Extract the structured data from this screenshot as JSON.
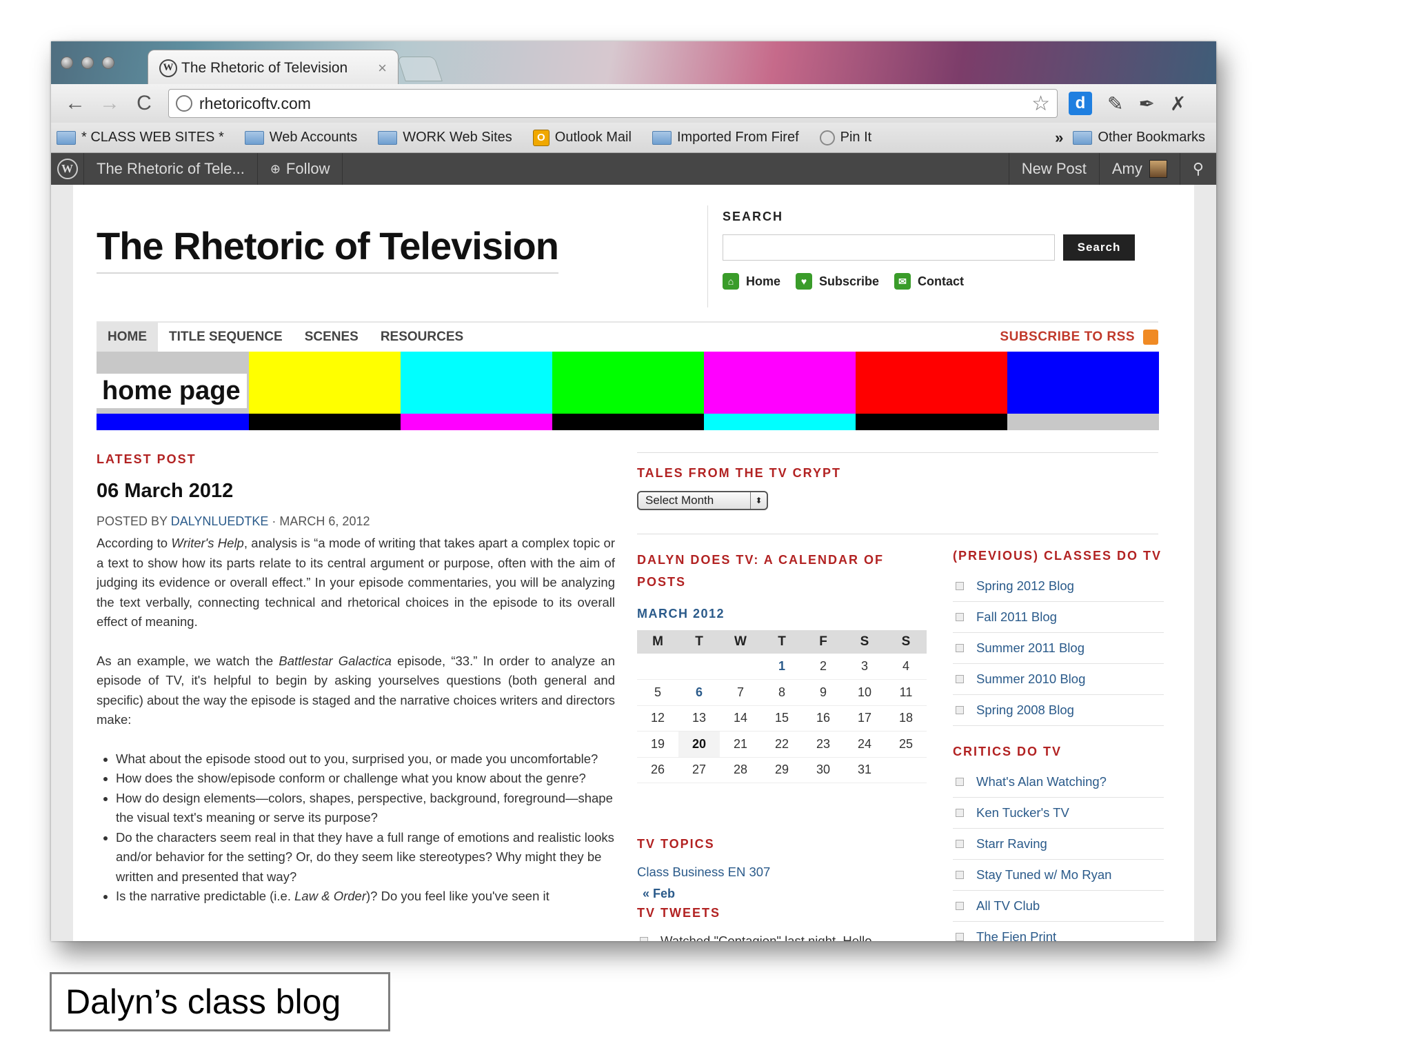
{
  "browser": {
    "tab_title": "The Rhetoric of Television",
    "tab_close": "×",
    "url": "rhetoricoftv.com",
    "nav": {
      "back": "←",
      "forward": "→",
      "reload": "C"
    },
    "star": "☆",
    "ext_d": "d",
    "ext_icons": [
      "puzzle-icon",
      "feather-icon",
      "wrench-icon"
    ],
    "bookmarks": [
      {
        "label": "* CLASS WEB SITES *",
        "kind": "folder"
      },
      {
        "label": "Web Accounts",
        "kind": "folder"
      },
      {
        "label": "WORK Web Sites",
        "kind": "folder"
      },
      {
        "label": "Outlook Mail",
        "kind": "outlook"
      },
      {
        "label": "Imported From Firef",
        "kind": "folder"
      },
      {
        "label": "Pin It",
        "kind": "pin"
      }
    ],
    "bookmarks_more": "»",
    "other_bookmarks": "Other Bookmarks"
  },
  "adminbar": {
    "site": "The Rhetoric of Tele...",
    "follow": "Follow",
    "follow_icon": "⊕",
    "new_post": "New Post",
    "user": "Amy",
    "search_icon": "⚲"
  },
  "header": {
    "site_title": "The Rhetoric of Television",
    "search_label": "SEARCH",
    "search_placeholder": "",
    "search_button": "Search",
    "quicklinks": [
      {
        "label": "Home",
        "icon": "⌂"
      },
      {
        "label": "Subscribe",
        "icon": "♥"
      },
      {
        "label": "Contact",
        "icon": "✉"
      }
    ]
  },
  "nav": {
    "items": [
      "HOME",
      "TITLE SEQUENCE",
      "SCENES",
      "RESOURCES"
    ],
    "active": "HOME",
    "rss": "SUBSCRIBE TO RSS"
  },
  "banner": {
    "label": "home page",
    "top_colors": [
      "#c8c8c8",
      "#ffff00",
      "#00ffff",
      "#00ff00",
      "#ff00ff",
      "#ff0000",
      "#0000ff"
    ],
    "bottom_colors": [
      "#0000ff",
      "#000000",
      "#ff00ff",
      "#000000",
      "#00ffff",
      "#000000",
      "#c8c8c8"
    ]
  },
  "post": {
    "section": "LATEST POST",
    "title": "06 March 2012",
    "byline_prefix": "POSTED BY ",
    "author": "DALYNLUEDTKE",
    "date": " · MARCH 6, 2012",
    "p1_a": "According to ",
    "p1_em": "Writer's Help",
    "p1_b": ", analysis is “a mode of writing that takes apart a complex topic or a text to show how its parts relate to its central argument or purpose, often with the aim of judging its evidence or overall effect.” In your episode commentaries, you will be analyzing the text verbally, connecting technical and rhetorical choices in the episode to its overall effect of meaning.",
    "p2_a": "As an example, we watch the ",
    "p2_em": "Battlestar Galactica",
    "p2_b": " episode, “33.” In order to analyze an episode of TV, it's helpful to begin by asking yourselves questions (both general and specific) about the way the episode is staged and the narrative choices writers and directors make:",
    "bullets": [
      "What about the episode stood out to you, surprised you, or made you uncomfortable?",
      "How does the show/episode conform or challenge what you know about the genre?",
      "How do design elements—colors, shapes, perspective, background, foreground—shape the visual text's meaning or serve its purpose?",
      "Do the characters seem real in that they have a full range of emotions and realistic looks and/or behavior for the setting? Or, do they seem like stereotypes? Why might they be written and presented that way?"
    ],
    "last_bullet_a": "Is the narrative predictable (i.e. ",
    "last_bullet_em": "Law & Order",
    "last_bullet_b": ")? Do you feel like you've seen it"
  },
  "sidebar": {
    "archive_heading": "TALES FROM THE TV CRYPT",
    "select_month": "Select Month",
    "select_arrow": "⬍",
    "calendar_heading": "DALYN DOES TV: A CALENDAR OF POSTS",
    "calendar_month": "MARCH 2012",
    "weekdays": [
      "M",
      "T",
      "W",
      "T",
      "F",
      "S",
      "S"
    ],
    "weeks": [
      [
        "",
        "",
        "",
        "1",
        "2",
        "3",
        "4"
      ],
      [
        "5",
        "6",
        "7",
        "8",
        "9",
        "10",
        "11"
      ],
      [
        "12",
        "13",
        "14",
        "15",
        "16",
        "17",
        "18"
      ],
      [
        "19",
        "20",
        "21",
        "22",
        "23",
        "24",
        "25"
      ],
      [
        "26",
        "27",
        "28",
        "29",
        "30",
        "31",
        ""
      ]
    ],
    "linked_days": [
      "1",
      "6"
    ],
    "today": "20",
    "prev_link": "« Feb",
    "topics_heading": "TV TOPICS",
    "topic": "Class Business EN 307",
    "tweets_heading": "TV TWEETS",
    "tweet": "Watched \"Contagion\" last night. Hello",
    "classes_heading": "(PREVIOUS) CLASSES DO TV",
    "classes": [
      "Spring 2012 Blog",
      "Fall 2011 Blog",
      "Summer 2011 Blog",
      "Summer 2010 Blog",
      "Spring 2008 Blog"
    ],
    "critics_heading": "CRITICS DO TV",
    "critics": [
      "What's Alan Watching?",
      "Ken Tucker's TV",
      "Starr Raving",
      "Stay Tuned w/ Mo Ryan",
      "All TV Club",
      "The Fien Print"
    ]
  },
  "caption": "Dalyn’s class blog"
}
